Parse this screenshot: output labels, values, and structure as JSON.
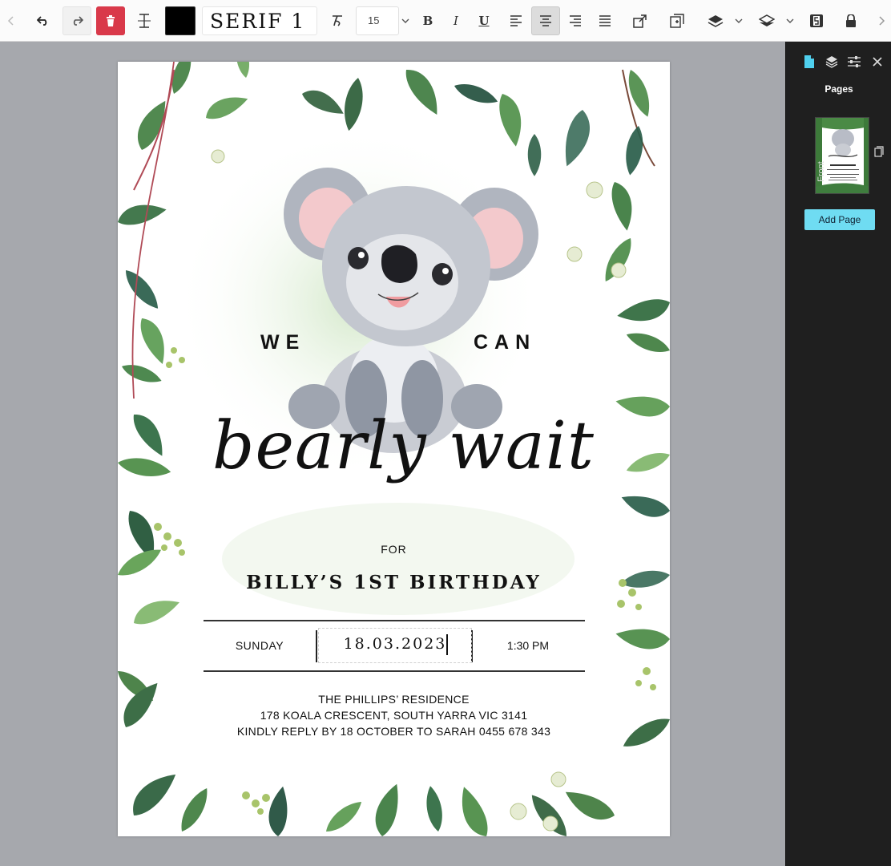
{
  "toolbar": {
    "font_name": "SERIF 1",
    "font_size": "15",
    "text_color": "#000000",
    "buttons": [
      "back",
      "undo",
      "redo",
      "delete",
      "text-spacing",
      "text-color",
      "font-family",
      "font-style",
      "font-size",
      "bold",
      "italic",
      "underline",
      "align-left",
      "align-center",
      "align-right",
      "align-justify",
      "resize",
      "duplicate",
      "layer-up",
      "layer-down",
      "save",
      "lock",
      "forward"
    ],
    "active_alignment": "center",
    "bold_label": "B",
    "italic_label": "I",
    "underline_label": "U"
  },
  "invitation": {
    "we": "WE",
    "can": "CAN",
    "script_title": "bearly wait",
    "for": "FOR",
    "birthday": "BILLY’S 1ST BIRTHDAY",
    "day": "SUNDAY",
    "date": "18.03.2023",
    "time": "1:30 PM",
    "address_line1": "THE PHILLIPS’ RESIDENCE",
    "address_line2": "178 KOALA CRESCENT, SOUTH YARRA VIC 3141",
    "address_line3": "KINDLY REPLY BY 18 OCTOBER TO SARAH 0455 678 343"
  },
  "sidebar": {
    "title": "Pages",
    "page_label": "Front",
    "add_page_label": "Add Page",
    "tabs": [
      "pages-tab",
      "layers-tab",
      "settings-tab",
      "close"
    ],
    "active_tab": "pages-tab",
    "accent_color": "#6fdcf2"
  },
  "colors": {
    "delete_button": "#d9394a",
    "canvas_background": "#a6a8ad",
    "sidebar_background": "#1f1f1f",
    "leaf_green": "#3d7a3a"
  }
}
